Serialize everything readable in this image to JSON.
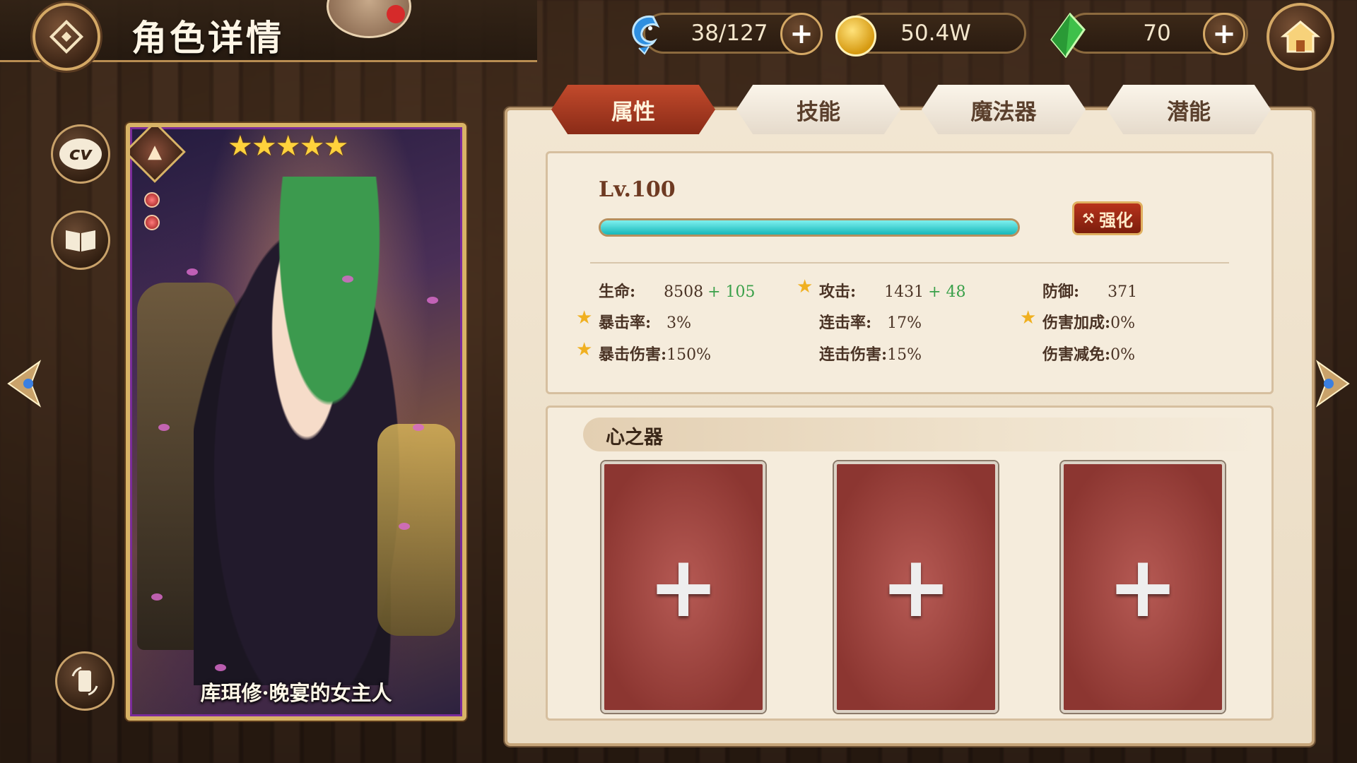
{
  "header": {
    "title": "角色详情"
  },
  "resources": {
    "stamina": {
      "value": "38/127",
      "icon": "blue-fish-icon"
    },
    "gold": {
      "value": "50.4W",
      "icon": "gold-coin-icon"
    },
    "gem": {
      "value": "70",
      "icon": "green-crystal-icon"
    }
  },
  "card": {
    "name": "库珥修·晚宴的女主人",
    "stars": "★★★★★",
    "star_count": 5
  },
  "tabs": [
    {
      "label": "属性",
      "active": true
    },
    {
      "label": "技能",
      "active": false
    },
    {
      "label": "魔法器",
      "active": false
    },
    {
      "label": "潜能",
      "active": false
    }
  ],
  "level": {
    "label": "Lv.100",
    "progress": 1.0,
    "upgrade_label": "强化"
  },
  "stats": {
    "hp": {
      "label": "生命:",
      "value": "8508",
      "bonus": "+ 105"
    },
    "atk": {
      "label": "攻击:",
      "value": "1431",
      "bonus": "+ 48"
    },
    "def": {
      "label": "防御:",
      "value": "371"
    },
    "crit_rate": {
      "label": "暴击率:",
      "value": "3%"
    },
    "combo_rate": {
      "label": "连击率:",
      "value": "17%"
    },
    "dmg_bonus": {
      "label": "伤害加成:",
      "value": "0%"
    },
    "crit_dmg": {
      "label": "暴击伤害:",
      "value": "150%"
    },
    "combo_dmg": {
      "label": "连击伤害:",
      "value": "15%"
    },
    "dmg_reduce": {
      "label": "伤害减免:",
      "value": "0%"
    }
  },
  "heart": {
    "title": "心之器",
    "slots": [
      "+",
      "+",
      "+"
    ]
  },
  "colors": {
    "accent": "#c24a2c",
    "xp": "#16b7b9",
    "bonus": "#3aa04a"
  }
}
